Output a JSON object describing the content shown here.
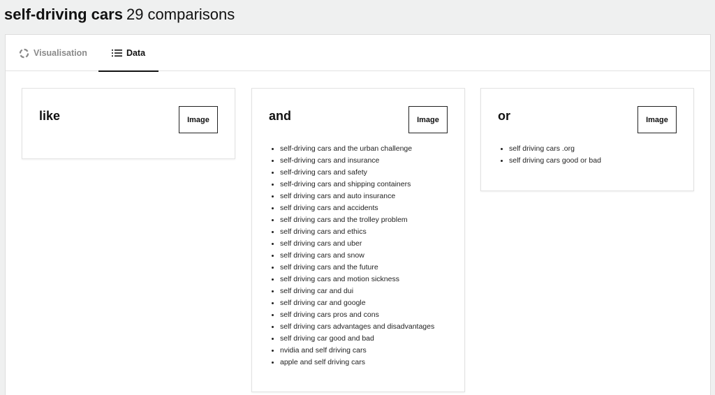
{
  "header": {
    "term": "self-driving cars",
    "count_label": "29 comparisons"
  },
  "tabs": [
    {
      "label": "Visualisation",
      "icon": "circle-loader-icon",
      "active": false
    },
    {
      "label": "Data",
      "icon": "list-icon",
      "active": true
    }
  ],
  "groups": [
    {
      "title": "like",
      "button_label": "Image",
      "items": []
    },
    {
      "title": "and",
      "button_label": "Image",
      "items": [
        "self-driving cars and the urban challenge",
        "self-driving cars and insurance",
        "self-driving cars and safety",
        "self-driving cars and shipping containers",
        "self driving cars and auto insurance",
        "self driving cars and accidents",
        "self driving cars and the trolley problem",
        "self driving cars and ethics",
        "self driving cars and uber",
        "self driving cars and snow",
        "self driving cars and the future",
        "self driving cars and motion sickness",
        "self driving car and dui",
        "self driving car and google",
        "self driving cars pros and cons",
        "self driving cars advantages and disadvantages",
        "self driving car good and bad",
        "nvidia and self driving cars",
        "apple and self driving cars"
      ]
    },
    {
      "title": "or",
      "button_label": "Image",
      "items": [
        "self driving cars .org",
        "self driving cars good or bad"
      ]
    }
  ],
  "colors": {
    "background": "#eff0f0",
    "panel": "#ffffff",
    "active_tab_underline": "#111111",
    "inactive_tab_text": "#8a8a8a"
  }
}
